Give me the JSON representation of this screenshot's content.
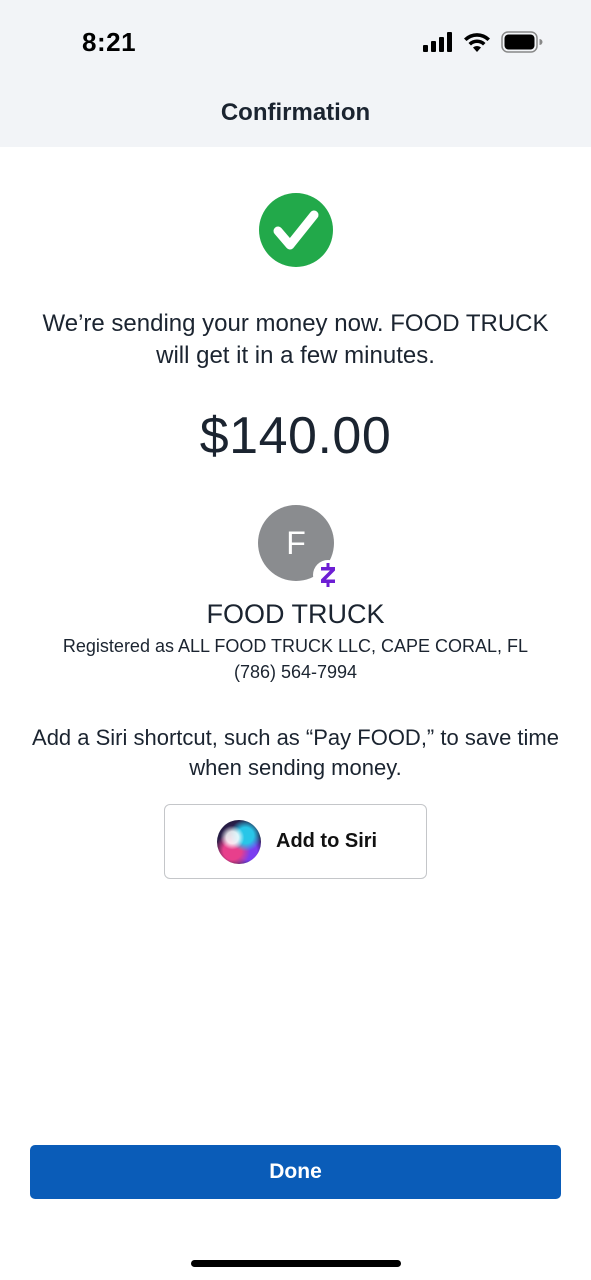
{
  "status_bar": {
    "time": "8:21",
    "icons": [
      "signal-icon",
      "wifi-icon",
      "battery-icon"
    ]
  },
  "header": {
    "title": "Confirmation"
  },
  "confirmation": {
    "status_icon": "checkmark-circle-icon",
    "status_color": "#22a94a",
    "message": "We’re sending your money now. FOOD TRUCK will get it in a few minutes.",
    "amount": "$140.00"
  },
  "recipient": {
    "initial": "F",
    "badge_icon": "zelle-logo-icon",
    "badge_color": "#6d1ed4",
    "name": "FOOD TRUCK",
    "registered": "Registered as ALL FOOD TRUCK LLC, CAPE CORAL, FL",
    "phone": "(786) 564-7994"
  },
  "siri": {
    "description": "Add a Siri shortcut, such as “Pay FOOD,” to save time when sending money.",
    "button_label": "Add to Siri",
    "button_icon": "siri-icon"
  },
  "footer": {
    "done_label": "Done",
    "accent_color": "#0a5cb8"
  }
}
